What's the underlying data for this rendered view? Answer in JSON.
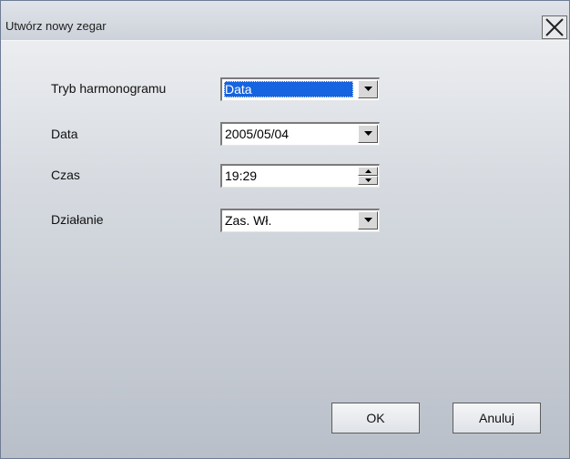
{
  "dialog": {
    "title": "Utwórz nowy zegar"
  },
  "form": {
    "schedule_mode": {
      "label": "Tryb harmonogramu",
      "value": "Data"
    },
    "date": {
      "label": "Data",
      "value": "2005/05/04"
    },
    "time": {
      "label": "Czas",
      "value": "19:29"
    },
    "action": {
      "label": "Działanie",
      "value": "Zas. Wł."
    }
  },
  "buttons": {
    "ok": "OK",
    "cancel": "Anuluj"
  },
  "icons": {
    "close": "close-icon",
    "dropdown": "chevron-down-icon",
    "spin_up": "spin-up-icon",
    "spin_down": "spin-down-icon"
  },
  "colors": {
    "selection": "#1664e0",
    "dialog_background": "#d7dbe1",
    "title_background": "#cdd2da"
  }
}
